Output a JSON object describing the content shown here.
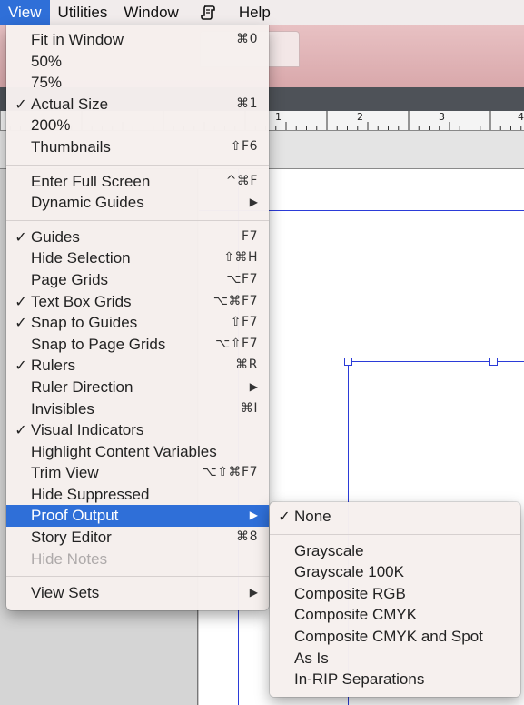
{
  "menubar": {
    "items": [
      "View",
      "Utilities",
      "Window",
      "Help"
    ],
    "script_icon": "script-icon"
  },
  "ruler": {
    "numbers": [
      "1",
      "2",
      "3",
      "4"
    ]
  },
  "view_menu": {
    "groups": [
      [
        {
          "label": "Fit in Window",
          "shortcut": "⌘0",
          "checked": false
        },
        {
          "label": "50%",
          "shortcut": "",
          "checked": false
        },
        {
          "label": "75%",
          "shortcut": "",
          "checked": false
        },
        {
          "label": "Actual Size",
          "shortcut": "⌘1",
          "checked": true
        },
        {
          "label": "200%",
          "shortcut": "",
          "checked": false
        },
        {
          "label": "Thumbnails",
          "shortcut": "⇧F6",
          "checked": false
        }
      ],
      [
        {
          "label": "Enter Full Screen",
          "shortcut": "^⌘F",
          "checked": false
        },
        {
          "label": "Dynamic Guides",
          "shortcut": "",
          "submenu": true,
          "checked": false
        }
      ],
      [
        {
          "label": "Guides",
          "shortcut": "F7",
          "checked": true
        },
        {
          "label": "Hide Selection",
          "shortcut": "⇧⌘H",
          "checked": false
        },
        {
          "label": "Page Grids",
          "shortcut": "⌥F7",
          "checked": false
        },
        {
          "label": "Text Box Grids",
          "shortcut": "⌥⌘F7",
          "checked": true
        },
        {
          "label": "Snap to Guides",
          "shortcut": "⇧F7",
          "checked": true
        },
        {
          "label": "Snap to Page Grids",
          "shortcut": "⌥⇧F7",
          "checked": false
        },
        {
          "label": "Rulers",
          "shortcut": "⌘R",
          "checked": true
        },
        {
          "label": "Ruler Direction",
          "shortcut": "",
          "submenu": true,
          "checked": false
        },
        {
          "label": "Invisibles",
          "shortcut": "⌘I",
          "checked": false
        },
        {
          "label": "Visual Indicators",
          "shortcut": "",
          "checked": true
        },
        {
          "label": "Highlight Content Variables",
          "shortcut": "",
          "checked": false
        },
        {
          "label": "Trim View",
          "shortcut": "⌥⇧⌘F7",
          "checked": false
        },
        {
          "label": "Hide Suppressed",
          "shortcut": "",
          "checked": false
        },
        {
          "label": "Proof Output",
          "shortcut": "",
          "submenu": true,
          "highlighted": true,
          "checked": false
        },
        {
          "label": "Story Editor",
          "shortcut": "⌘8",
          "checked": false
        },
        {
          "label": "Hide Notes",
          "shortcut": "",
          "disabled": true,
          "checked": false
        }
      ],
      [
        {
          "label": "View Sets",
          "shortcut": "",
          "submenu": true,
          "checked": false
        }
      ]
    ]
  },
  "proof_output_submenu": {
    "groups": [
      [
        {
          "label": "None",
          "checked": true
        }
      ],
      [
        {
          "label": "Grayscale",
          "checked": false
        },
        {
          "label": "Grayscale 100K",
          "checked": false
        },
        {
          "label": "Composite RGB",
          "checked": false
        },
        {
          "label": "Composite CMYK",
          "checked": false
        },
        {
          "label": "Composite CMYK and Spot",
          "checked": false
        },
        {
          "label": "As Is",
          "checked": false
        },
        {
          "label": "In-RIP Separations",
          "checked": false
        }
      ]
    ]
  },
  "colors": {
    "highlight": "#2f6fd8",
    "guide": "#2b3bd8",
    "menu_bg": "#f6f0ee"
  }
}
